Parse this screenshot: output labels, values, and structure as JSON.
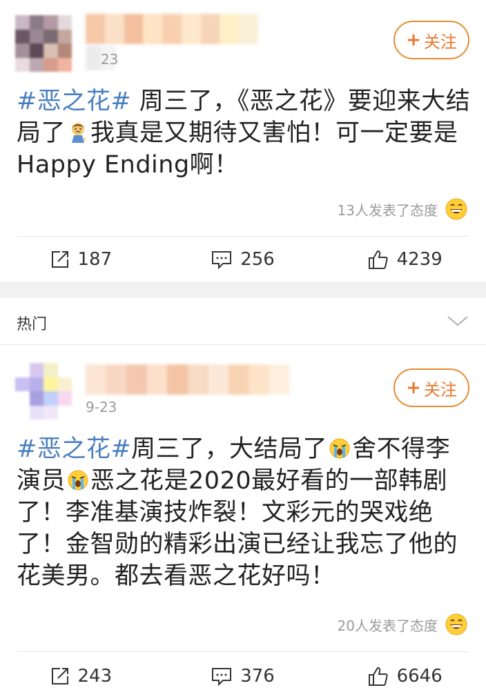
{
  "posts": [
    {
      "time": "23",
      "follow_label": "关注",
      "hashtag": "#恶之花#",
      "text_a": "周三了，《恶之花》要迎来大结局了",
      "emoji_1": "crying-baby-emoji",
      "text_b": "我真是又期待又害怕！可一定要是Happy Ending啊！",
      "attitude": "13人发表了态度",
      "attitude_emoji": "grin-emoji",
      "repost_count": "187",
      "comment_count": "256",
      "like_count": "4239"
    },
    {
      "time": "9-23",
      "follow_label": "关注",
      "hashtag": "#恶之花#",
      "text_a": "周三了，大结局了",
      "emoji_1": "loud-crying-emoji",
      "text_b": "舍不得李演员",
      "emoji_2": "loud-crying-emoji",
      "text_c": "恶之花是2020最好看的一部韩剧了！李准基演技炸裂！文彩元的哭戏绝了！金智勋的精彩出演已经让我忘了他的花美男。都去看恶之花好吗！",
      "attitude": "20人发表了态度",
      "attitude_emoji": "grin-emoji",
      "repost_count": "243",
      "comment_count": "376",
      "like_count": "6646"
    }
  ],
  "section": {
    "title": "热门"
  },
  "colors": {
    "accent": "#e8772e",
    "hashtag": "#4a7fbf",
    "muted": "#9a9a9a",
    "gap": "#f2f2f2"
  }
}
